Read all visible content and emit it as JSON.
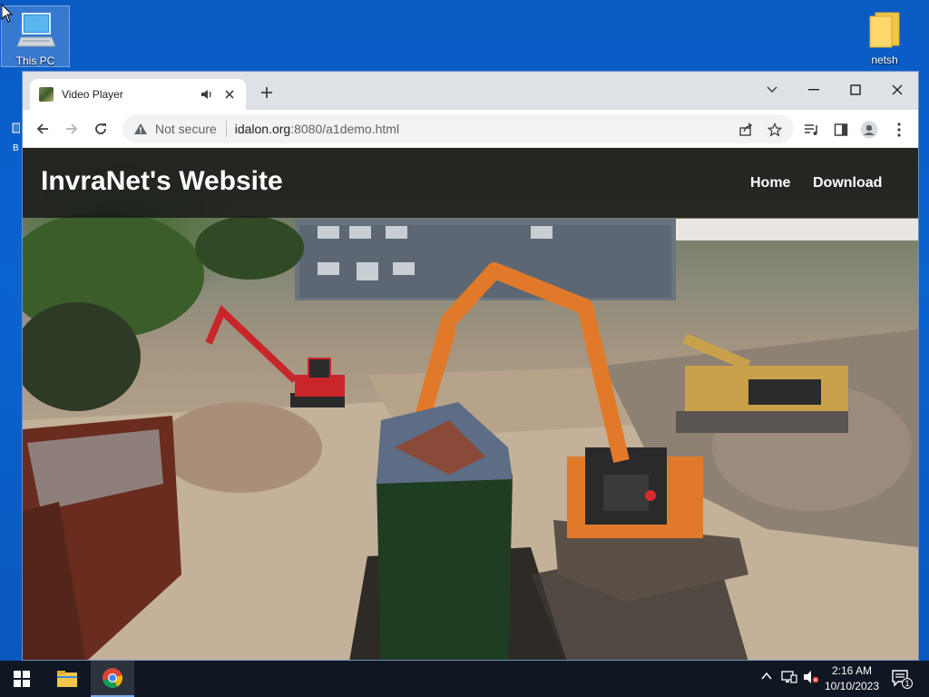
{
  "desktop": {
    "icons": [
      {
        "label": "This PC"
      },
      {
        "label": "netsh"
      }
    ],
    "left_stub_label": "B"
  },
  "browser": {
    "tab": {
      "title": "Video Player"
    },
    "address": {
      "security_label": "Not secure",
      "host": "idalon.org",
      "rest": ":8080/a1demo.html"
    }
  },
  "site": {
    "title": "InvraNet's Website",
    "nav": [
      {
        "label": "Home"
      },
      {
        "label": "Download"
      }
    ]
  },
  "taskbar": {
    "time": "2:16 AM",
    "date": "10/10/2023",
    "notification_count": "1"
  },
  "colors": {
    "desktop_bg": "#0b63d0",
    "tab_strip": "#dee1e6",
    "header_overlay": "#191919",
    "excavator_orange": "#e07a2a",
    "excavator_red": "#c8262a"
  }
}
